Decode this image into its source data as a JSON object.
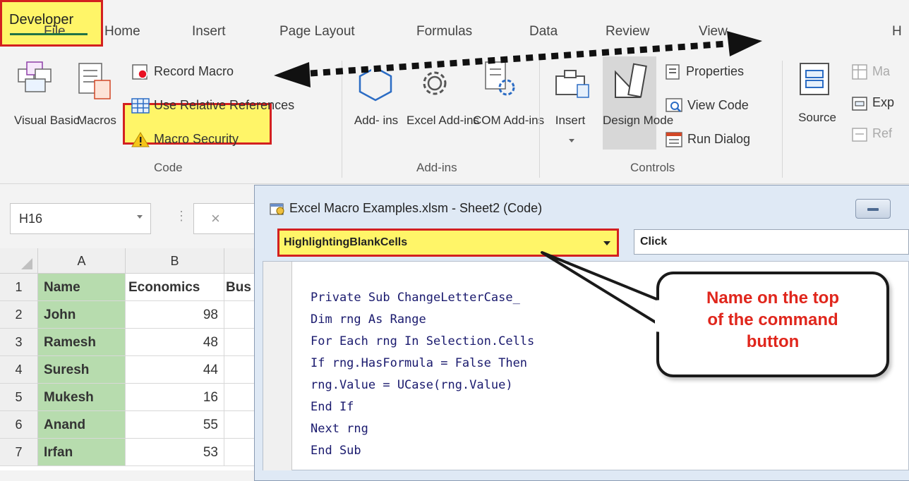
{
  "menu": {
    "tabs": [
      "File",
      "Home",
      "Insert",
      "Page Layout",
      "Formulas",
      "Data",
      "Review",
      "View",
      "Developer",
      "H"
    ],
    "active_tab": "Developer"
  },
  "ribbon": {
    "code_group": {
      "label": "Code",
      "visual_basic": "Visual Basic",
      "macros": "Macros",
      "record_macro": "Record Macro",
      "use_relative_references": "Use Relative References",
      "macro_security": "Macro Security"
    },
    "addins_group": {
      "label": "Add-ins",
      "addins": "Add- ins",
      "excel_addins": "Excel Add-ins",
      "com_addins": "COM Add-ins"
    },
    "controls_group": {
      "label": "Controls",
      "insert": "Insert",
      "design_mode": "Design Mode",
      "properties": "Properties",
      "view_code": "View Code",
      "run_dialog": "Run Dialog"
    },
    "xml_group": {
      "source": "Source",
      "map_properties": "Ma",
      "expansion_packs": "Exp",
      "refresh_data": "Ref"
    }
  },
  "sheet": {
    "name_box": "H16",
    "columns": [
      "A",
      "B"
    ],
    "header_row": [
      "Name",
      "Economics",
      "Bus"
    ],
    "rows": [
      {
        "num": "1"
      },
      {
        "num": "2",
        "name": "John",
        "value": "98"
      },
      {
        "num": "3",
        "name": "Ramesh",
        "value": "48"
      },
      {
        "num": "4",
        "name": "Suresh",
        "value": "44"
      },
      {
        "num": "5",
        "name": "Mukesh",
        "value": "16"
      },
      {
        "num": "6",
        "name": "Anand",
        "value": "55"
      },
      {
        "num": "7",
        "name": "Irfan",
        "value": "53"
      }
    ]
  },
  "vba": {
    "title": "Excel Macro Examples.xlsm - Sheet2 (Code)",
    "object_dropdown": "HighlightingBlankCells",
    "procedure_dropdown": "Click",
    "code_lines": [
      "Private Sub ChangeLetterCase_",
      "Dim rng As Range",
      "For Each rng In Selection.Cells",
      "If rng.HasFormula = False Then",
      "rng.Value = UCase(rng.Value)",
      "End If",
      "Next rng",
      "End Sub"
    ]
  },
  "callout": {
    "lines": [
      "Name on the top",
      "of the command",
      "button"
    ]
  },
  "colors": {
    "highlight_yellow": "#fff568",
    "highlight_red_border": "#d32020",
    "excel_green": "#217346",
    "name_column_fill": "#b7dcae",
    "callout_text": "#e0261c"
  }
}
